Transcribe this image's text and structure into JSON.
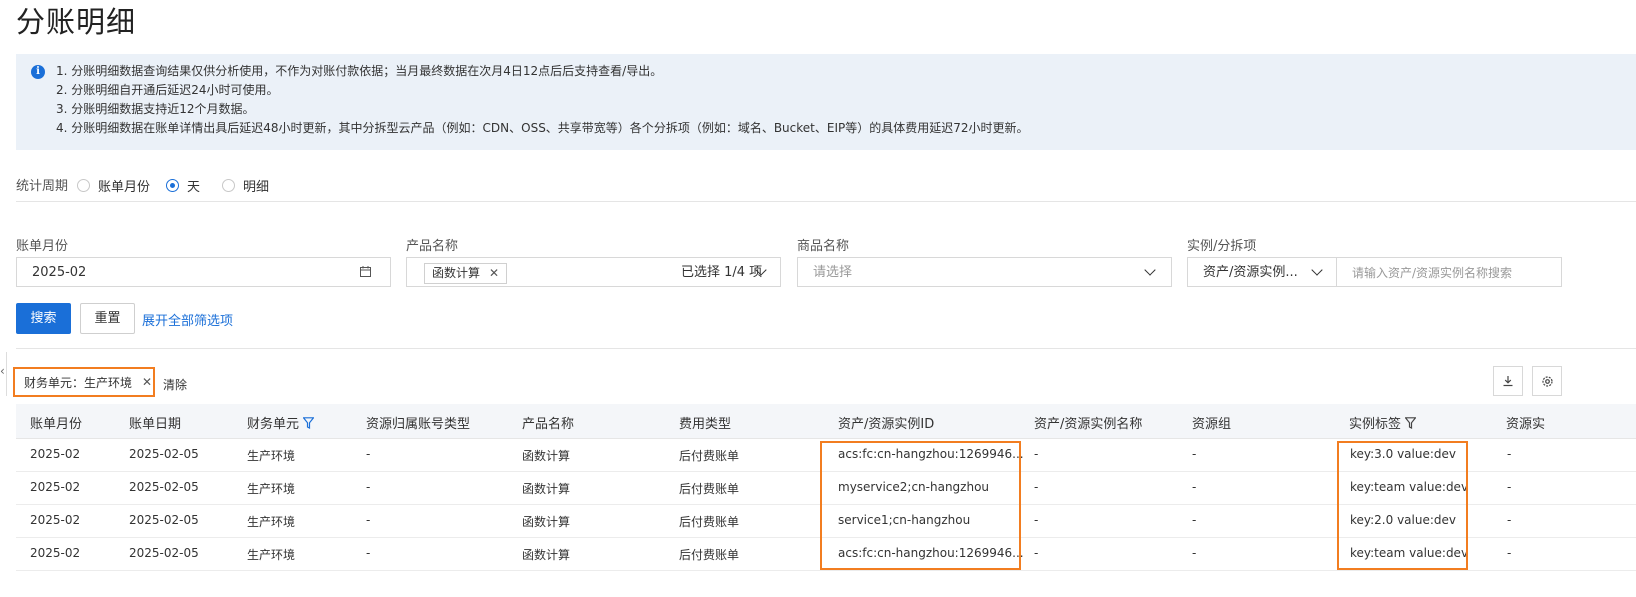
{
  "page_title": "分账明细",
  "notice": {
    "lines": [
      "1. 分账明细数据查询结果仅供分析使用，不作为对账付款依据；当月最终数据在次月4日12点后后支持查看/导出。",
      "2. 分账明细自开通后延迟24小时可使用。",
      "3. 分账明细数据支持近12个月数据。",
      "4. 分账明细数据在账单详情出具后延迟48小时更新，其中分拆型云产品（例如：CDN、OSS、共享带宽等）各个分拆项（例如：域名、Bucket、EIP等）的具体费用延迟72小时更新。"
    ]
  },
  "period": {
    "label": "统计周期",
    "options": [
      "账单月份",
      "天",
      "明细"
    ],
    "selected": "天"
  },
  "filters": {
    "bill_month": {
      "label": "账单月份",
      "value": "2025-02"
    },
    "product": {
      "label": "产品名称",
      "tag": "函数计算",
      "summary": "已选择 1/4 项"
    },
    "commodity": {
      "label": "商品名称",
      "placeholder": "请选择"
    },
    "instance": {
      "label": "实例/分拆项",
      "type_value": "资产/资源实例...",
      "placeholder": "请输入资产/资源实例名称搜索"
    }
  },
  "actions": {
    "search": "搜索",
    "reset": "重置",
    "expand": "展开全部筛选项"
  },
  "active_filter": {
    "text": "财务单元：生产环境",
    "clear": "清除"
  },
  "toolbar_icons": [
    "download-icon",
    "settings-icon"
  ],
  "table": {
    "columns": [
      "账单月份",
      "账单日期",
      "财务单元",
      "资源归属账号类型",
      "产品名称",
      "费用类型",
      "资产/资源实例ID",
      "资产/资源实例名称",
      "资源组",
      "实例标签",
      "资源实"
    ],
    "rows": [
      [
        "2025-02",
        "2025-02-05",
        "生产环境",
        "-",
        "函数计算",
        "后付费账单",
        "acs:fc:cn-hangzhou:1269946...",
        "-",
        "-",
        "key:3.0 value:dev",
        "-"
      ],
      [
        "2025-02",
        "2025-02-05",
        "生产环境",
        "-",
        "函数计算",
        "后付费账单",
        "myservice2;cn-hangzhou",
        "-",
        "-",
        "key:team value:dev",
        "-"
      ],
      [
        "2025-02",
        "2025-02-05",
        "生产环境",
        "-",
        "函数计算",
        "后付费账单",
        "service1;cn-hangzhou",
        "-",
        "-",
        "key:2.0 value:dev",
        "-"
      ],
      [
        "2025-02",
        "2025-02-05",
        "生产环境",
        "-",
        "函数计算",
        "后付费账单",
        "acs:fc:cn-hangzhou:1269946...",
        "-",
        "-",
        "key:team value:dev",
        "-"
      ]
    ]
  },
  "colors": {
    "accent": "#1a6fd8",
    "highlight": "#f27d20",
    "notice_bg": "#ebf1f8"
  }
}
